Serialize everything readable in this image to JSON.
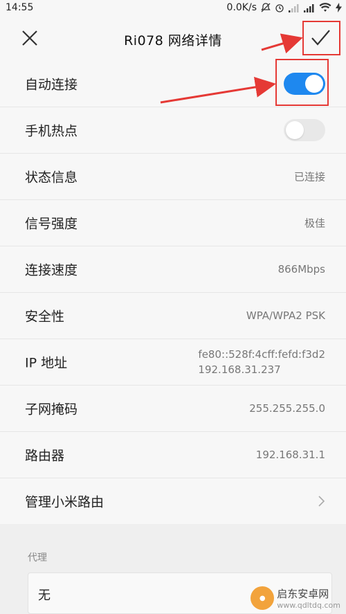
{
  "status_bar": {
    "time": "14:55",
    "net_speed": "0.0K/s"
  },
  "header": {
    "title": "Ri078  网络详情"
  },
  "rows": [
    {
      "label": "自动连接",
      "type": "toggle",
      "on": true
    },
    {
      "label": "手机热点",
      "type": "toggle",
      "on": false
    },
    {
      "label": "状态信息",
      "type": "value",
      "value": "已连接"
    },
    {
      "label": "信号强度",
      "type": "value",
      "value": "极佳"
    },
    {
      "label": "连接速度",
      "type": "value",
      "value": "866Mbps"
    },
    {
      "label": "安全性",
      "type": "value",
      "value": "WPA/WPA2 PSK"
    },
    {
      "label": "IP 地址",
      "type": "value2",
      "value": "fe80::528f:4cff:fefd:f3d2",
      "value2": "192.168.31.237"
    },
    {
      "label": "子网掩码",
      "type": "value",
      "value": "255.255.255.0"
    },
    {
      "label": "路由器",
      "type": "value",
      "value": "192.168.31.1"
    },
    {
      "label": "管理小米路由",
      "type": "link"
    }
  ],
  "proxy": {
    "title": "代理",
    "value": "无"
  },
  "watermark": {
    "brand": "启东安卓网",
    "url": "www.qdltdq.com"
  },
  "colors": {
    "toggle_on": "#1e88ef",
    "annotation": "#e53935"
  }
}
